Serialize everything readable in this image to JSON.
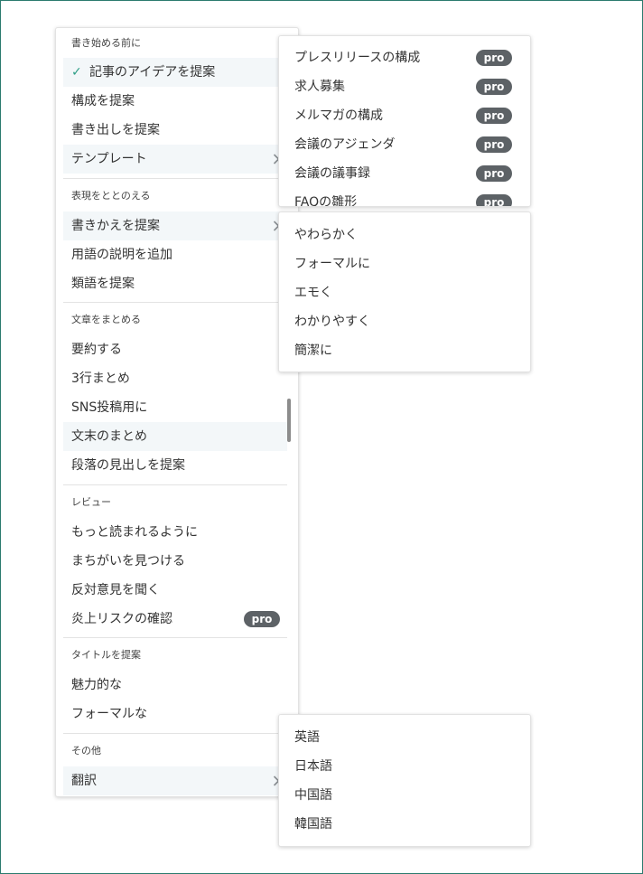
{
  "main_menu": {
    "sections": [
      {
        "header": "書き始める前に",
        "items": [
          {
            "label": "記事のアイデアを提案",
            "checked": true
          },
          {
            "label": "構成を提案"
          },
          {
            "label": "書き出しを提案"
          },
          {
            "label": "テンプレート",
            "has_submenu": true
          }
        ]
      },
      {
        "header": "表現をととのえる",
        "items": [
          {
            "label": "書きかえを提案",
            "has_submenu": true
          },
          {
            "label": "用語の説明を追加"
          },
          {
            "label": "類語を提案"
          }
        ]
      },
      {
        "header": "文章をまとめる",
        "items": [
          {
            "label": "要約する"
          },
          {
            "label": "3行まとめ"
          },
          {
            "label": "SNS投稿用に"
          },
          {
            "label": "文末のまとめ"
          },
          {
            "label": "段落の見出しを提案"
          }
        ]
      },
      {
        "header": "レビュー",
        "items": [
          {
            "label": "もっと読まれるように"
          },
          {
            "label": "まちがいを見つける"
          },
          {
            "label": "反対意見を聞く"
          },
          {
            "label": "炎上リスクの確認",
            "badge": "pro"
          }
        ]
      },
      {
        "header": "タイトルを提案",
        "items": [
          {
            "label": "魅力的な"
          },
          {
            "label": "フォーマルな"
          }
        ]
      },
      {
        "header": "その他",
        "items": [
          {
            "label": "翻訳",
            "has_submenu": true
          }
        ]
      }
    ]
  },
  "template_submenu": {
    "items": [
      {
        "label": "プレスリリースの構成",
        "badge": "pro"
      },
      {
        "label": "求人募集",
        "badge": "pro"
      },
      {
        "label": "メルマガの構成",
        "badge": "pro"
      },
      {
        "label": "会議のアジェンダ",
        "badge": "pro"
      },
      {
        "label": "会議の議事録",
        "badge": "pro"
      },
      {
        "label": "FAQの雛形",
        "badge": "pro"
      }
    ]
  },
  "rewrite_submenu": {
    "items": [
      {
        "label": "やわらかく"
      },
      {
        "label": "フォーマルに"
      },
      {
        "label": "エモく"
      },
      {
        "label": "わかりやすく"
      },
      {
        "label": "簡潔に"
      }
    ]
  },
  "translate_submenu": {
    "items": [
      {
        "label": "英語"
      },
      {
        "label": "日本語"
      },
      {
        "label": "中国語"
      },
      {
        "label": "韓国語"
      }
    ]
  },
  "colors": {
    "frame_border": "#2c7b6f",
    "check_mark": "#2e9e86",
    "pro_badge_bg": "#5d6266",
    "highlight_bg": "#f3f7f9"
  },
  "icons": {
    "check": "check-icon",
    "chevron": "chevron-right-icon"
  }
}
